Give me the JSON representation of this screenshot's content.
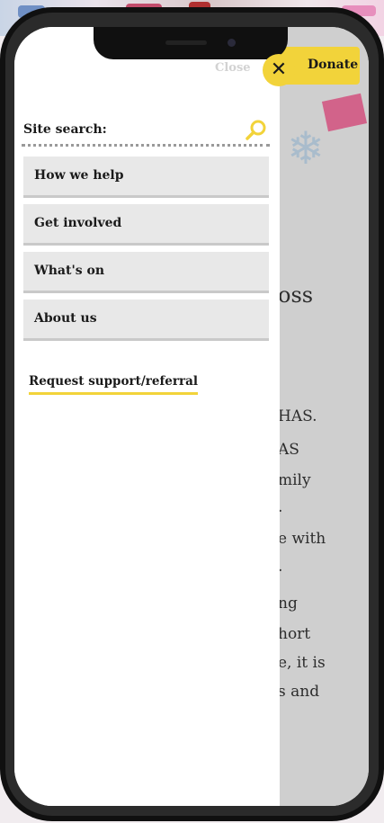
{
  "header": {
    "close_label": "Close",
    "close_icon": "close-x-icon",
    "donate_label": "Donate"
  },
  "search": {
    "label": "Site search:",
    "icon": "search-icon"
  },
  "nav": {
    "items": [
      {
        "label": "How we help"
      },
      {
        "label": "Get involved"
      },
      {
        "label": "What's on"
      },
      {
        "label": "About us"
      }
    ]
  },
  "referral_link": "Request support/referral",
  "background_page": {
    "heading_fragment": "oss",
    "lines": [
      "HAS.",
      "AS",
      "mily",
      ".",
      "e with",
      ".",
      "ng",
      "hort",
      "e, it is",
      "s and"
    ]
  },
  "colors": {
    "accent_yellow": "#f2d33a",
    "menu_item_bg": "#e8e8e8",
    "text": "#1a1a1a"
  }
}
